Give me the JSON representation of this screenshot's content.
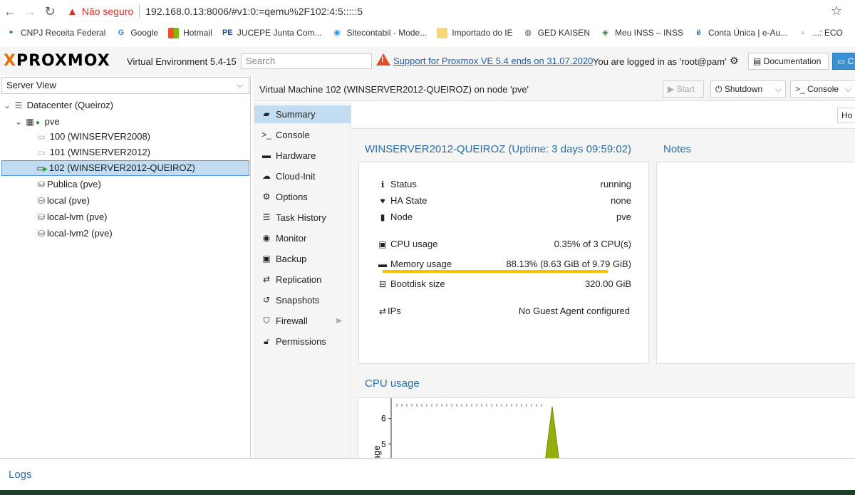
{
  "browser": {
    "insecure_label": "Não seguro",
    "url": "192.168.0.13:8006/#v1:0:=qemu%2F102:4:5:::::5",
    "bookmarks": [
      {
        "label": "CNPJ Receita Federal",
        "icon": "receita-icon"
      },
      {
        "label": "Google",
        "icon": "google-icon"
      },
      {
        "label": "Hotmail",
        "icon": "windows-icon"
      },
      {
        "label": "JUCEPE Junta Com...",
        "icon": "jucepe-icon"
      },
      {
        "label": "Sitecontabil - Mode...",
        "icon": "sitecontabil-icon"
      },
      {
        "label": "Importado do IE",
        "icon": "folder-icon"
      },
      {
        "label": "GED KAISEN",
        "icon": "globe-icon"
      },
      {
        "label": "Meu INSS – INSS",
        "icon": "inss-icon"
      },
      {
        "label": "Conta Única | e-Au...",
        "icon": "conta-icon"
      },
      {
        "label": "...: ECO",
        "icon": "eco-icon"
      }
    ]
  },
  "header": {
    "logo": "PROXMOX",
    "version": "Virtual Environment 5.4-15",
    "search_placeholder": "Search",
    "support_link": "Support for Proxmox VE 5.4 ends on 31.07.2020",
    "logged_in": "You are logged in as 'root@pam'",
    "documentation": "Documentation",
    "create_vm": "C"
  },
  "tree": {
    "view": "Server View",
    "datacenter": "Datacenter (Queiroz)",
    "node": "pve",
    "items": [
      {
        "label": "100 (WINSERVER2008)",
        "type": "vm"
      },
      {
        "label": "101 (WINSERVER2012)",
        "type": "vm"
      },
      {
        "label": "102 (WINSERVER2012-QUEIROZ)",
        "type": "vm-running"
      },
      {
        "label": "Publica (pve)",
        "type": "storage"
      },
      {
        "label": "local (pve)",
        "type": "storage"
      },
      {
        "label": "local-lvm (pve)",
        "type": "storage"
      },
      {
        "label": "local-lvm2 (pve)",
        "type": "storage"
      }
    ]
  },
  "vm": {
    "title": "Virtual Machine 102 (WINSERVER2012-QUEIROZ) on node 'pve'",
    "buttons": {
      "start": "Start",
      "shutdown": "Shutdown",
      "console": "Console"
    },
    "nav": [
      "Summary",
      "Console",
      "Hardware",
      "Cloud-Init",
      "Options",
      "Task History",
      "Monitor",
      "Backup",
      "Replication",
      "Snapshots",
      "Firewall",
      "Permissions"
    ],
    "hour_button": "Ho"
  },
  "summary": {
    "title": "WINSERVER2012-QUEIROZ (Uptime: 3 days 09:59:02)",
    "notes_title": "Notes",
    "status": [
      {
        "label": "Status",
        "value": "running",
        "icon": "info-icon"
      },
      {
        "label": "HA State",
        "value": "none",
        "icon": "heartbeat-icon"
      },
      {
        "label": "Node",
        "value": "pve",
        "icon": "building-icon"
      },
      {
        "label": "CPU usage",
        "value": "0.35% of 3 CPU(s)",
        "icon": "cpu-icon"
      },
      {
        "label": "Memory usage",
        "value": "88.13% (8.63 GiB of 9.79 GiB)",
        "icon": "memory-icon"
      },
      {
        "label": "Bootdisk size",
        "value": "320.00 GiB",
        "icon": "hdd-icon"
      },
      {
        "label": "IPs",
        "value": "No Guest Agent configured",
        "icon": "exchange-icon"
      }
    ],
    "memory_fraction": 0.8813
  },
  "cpu_chart": {
    "title": "CPU usage",
    "ylabel": "age",
    "chart_data": {
      "type": "area",
      "yticks": [
        4,
        5,
        6
      ],
      "ylim": [
        4,
        6.3
      ],
      "color": "#94ae0a"
    }
  },
  "logs": "Logs",
  "colors": {
    "accent": "#2a6fad",
    "selection": "#c2ddf2",
    "memory_bar": "#f5c200",
    "alert": "#e04e2c"
  }
}
